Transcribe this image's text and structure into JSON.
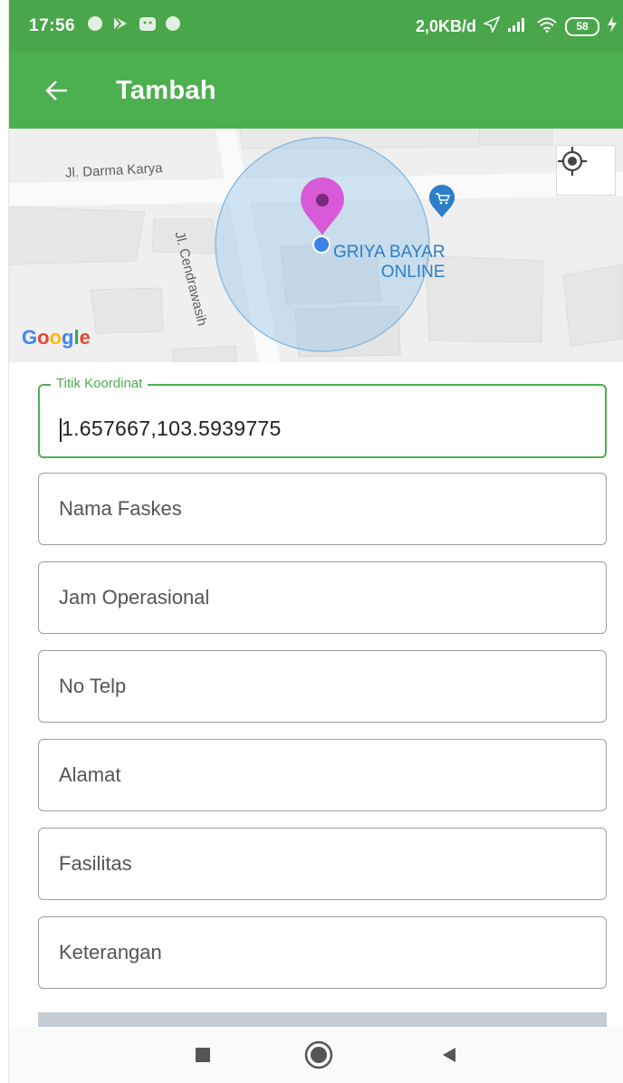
{
  "status_bar": {
    "time": "17:56",
    "network_speed": "2,0KB/d",
    "battery_level": "58",
    "icons": [
      "notification-dot-icon",
      "play-store-icon",
      "android-icon",
      "notification-dot-icon",
      "location-arrow-icon",
      "signal-icon",
      "wifi-icon",
      "battery-icon",
      "charging-bolt-icon"
    ]
  },
  "app_bar": {
    "title": "Tambah",
    "back_icon": "arrow-left-icon"
  },
  "map": {
    "street_1": "Jl. Darma Karya",
    "street_2": "Jl. Cendrawasih",
    "poi_line_1": "GRIYA BAYAR",
    "poi_line_2": "ONLINE",
    "logo": "Google",
    "locate_icon": "my-location-icon",
    "marker_color": "#d85ad8",
    "accuracy_circle_color": "#9cc8ec",
    "location_dot_color": "#3b82e6",
    "poi_color": "#2a7fc8"
  },
  "form": {
    "coordinate": {
      "label": "Titik Koordinat",
      "value": "1.657667,103.5939775"
    },
    "fields": [
      {
        "placeholder": "Nama Faskes"
      },
      {
        "placeholder": "Jam Operasional"
      },
      {
        "placeholder": "No Telp"
      },
      {
        "placeholder": "Alamat"
      },
      {
        "placeholder": "Fasilitas"
      },
      {
        "placeholder": "Keterangan"
      }
    ]
  },
  "nav_bar": {
    "icons": [
      "square-icon",
      "circle-icon",
      "triangle-back-icon"
    ]
  },
  "colors": {
    "status_bar": "#4aa64b",
    "app_bar": "#4caf50",
    "accent": "#4caf50"
  }
}
